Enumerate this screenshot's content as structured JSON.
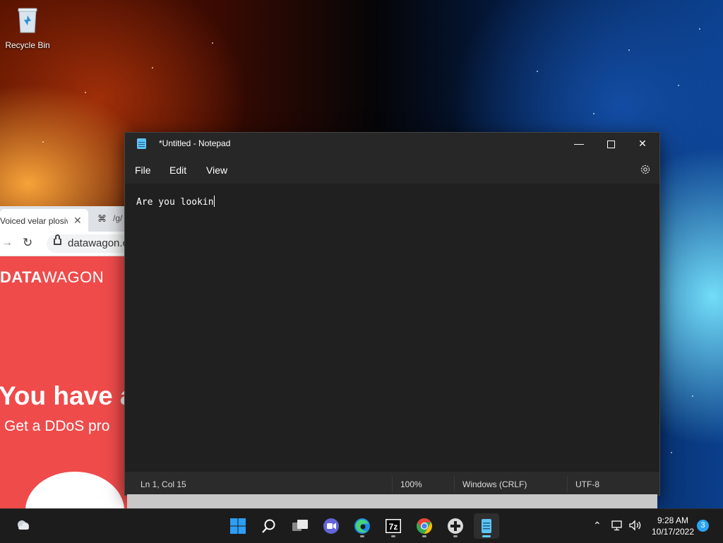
{
  "desktop": {
    "icons": [
      {
        "label": "Recycle Bin",
        "icon": "recycle-bin-icon"
      }
    ]
  },
  "browser": {
    "tab_title": "Voiced velar plosive",
    "second_tab_title": "/g/",
    "url": "datawagon.com",
    "brand_bold": "DATA",
    "brand_light": "WAGON",
    "headline": "You have a",
    "subline": "Get a DDoS pro",
    "page_color": "#ef4b4b"
  },
  "notepad": {
    "title": "*Untitled - Notepad",
    "menu": [
      "File",
      "Edit",
      "View"
    ],
    "content": "Are you lookin",
    "status": {
      "position": "Ln 1, Col 15",
      "zoom": "100%",
      "line_ending": "Windows (CRLF)",
      "encoding": "UTF-8"
    },
    "window_buttons": [
      "minimize-icon",
      "maximize-icon",
      "close-icon"
    ],
    "theme": {
      "background": "#202020",
      "chrome": "#272727",
      "text": "#ffffff"
    }
  },
  "taskbar": {
    "apps": [
      "start",
      "search",
      "task-view",
      "teams-chat",
      "edge",
      "7-zip",
      "chrome",
      "game-controller",
      "notepad"
    ],
    "active_app": "notepad",
    "clock": {
      "time": "9:28 AM",
      "date": "10/17/2022"
    },
    "notification_count": "3",
    "accent": "#60cdff"
  }
}
